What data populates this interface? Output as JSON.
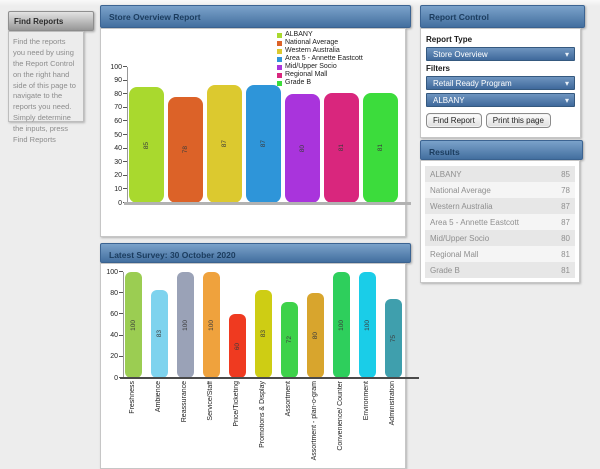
{
  "sidebar": {
    "title": "Find Reports",
    "body": "Find the reports you need by using the Report Control on the right hand side of this page to navigate to the reports you need. Simply determine the inputs, press Find Reports"
  },
  "report_control": {
    "title": "Report Control",
    "report_type_label": "Report Type",
    "report_type_value": "Store Overview",
    "filters_label": "Filters",
    "filter_program_value": "Retail Ready Program",
    "filter_store_value": "ALBANY",
    "find_button": "Find Report",
    "print_button": "Print this page"
  },
  "results": {
    "title": "Results",
    "rows": [
      {
        "label": "ALBANY",
        "value": 85
      },
      {
        "label": "National Average",
        "value": 78
      },
      {
        "label": "Western Australia",
        "value": 87
      },
      {
        "label": "Area 5 - Annette Eastcott",
        "value": 87
      },
      {
        "label": "Mid/Upper Socio",
        "value": 80
      },
      {
        "label": "Regional Mall",
        "value": 81
      },
      {
        "label": "Grade B",
        "value": 81
      }
    ]
  },
  "icons": {
    "chevron_down": "▾"
  },
  "colors": {
    "header_blue_top": "#7ba2ca",
    "header_blue_bottom": "#436f9f",
    "select_blue": "#4a75a6",
    "page_bg": "#ededed"
  },
  "chart_data": [
    {
      "type": "bar",
      "title": "Store Overview Report",
      "categories": [
        "ALBANY",
        "National Average",
        "Western Australia",
        "Area 5 - Annette Eastcott",
        "Mid/Upper Socio",
        "Regional Mall",
        "Grade B"
      ],
      "values": [
        85,
        78,
        87,
        87,
        80,
        81,
        81
      ],
      "colors": [
        "#a9d92e",
        "#dc6228",
        "#dcc92f",
        "#2e95d9",
        "#a934dc",
        "#d9267d",
        "#3cdc3c"
      ],
      "xlabel": "",
      "ylabel": "",
      "ylim": [
        0,
        100
      ],
      "ytick_step": 10,
      "grid": false,
      "legend": true,
      "legend_position": "top-right",
      "show_xlabels": false,
      "bar_value_labels": "rotated-inside"
    },
    {
      "type": "bar",
      "title": "Latest Survey: 30 October 2020",
      "categories": [
        "Freshness",
        "Ambience",
        "Reassurance",
        "Service/Staff",
        "Price/Ticketing",
        "Promotions & Display",
        "Assortment",
        "Assortment - plan-o-gram",
        "Convenience/ Counter",
        "Environment",
        "Administration"
      ],
      "values": [
        100,
        83,
        100,
        100,
        60,
        83,
        72,
        80,
        100,
        100,
        75
      ],
      "colors": [
        "#9bcd52",
        "#7ed3ee",
        "#9aa2b7",
        "#efa23d",
        "#ef3a20",
        "#cecd14",
        "#3ed24a",
        "#d8a52d",
        "#2ecf5c",
        "#1acde8",
        "#3f9fad"
      ],
      "xlabel": "",
      "ylabel": "",
      "ylim": [
        0,
        100
      ],
      "ytick_step": 20,
      "grid": false,
      "legend": false,
      "show_xlabels": true,
      "bar_value_labels": "rotated-inside"
    }
  ]
}
